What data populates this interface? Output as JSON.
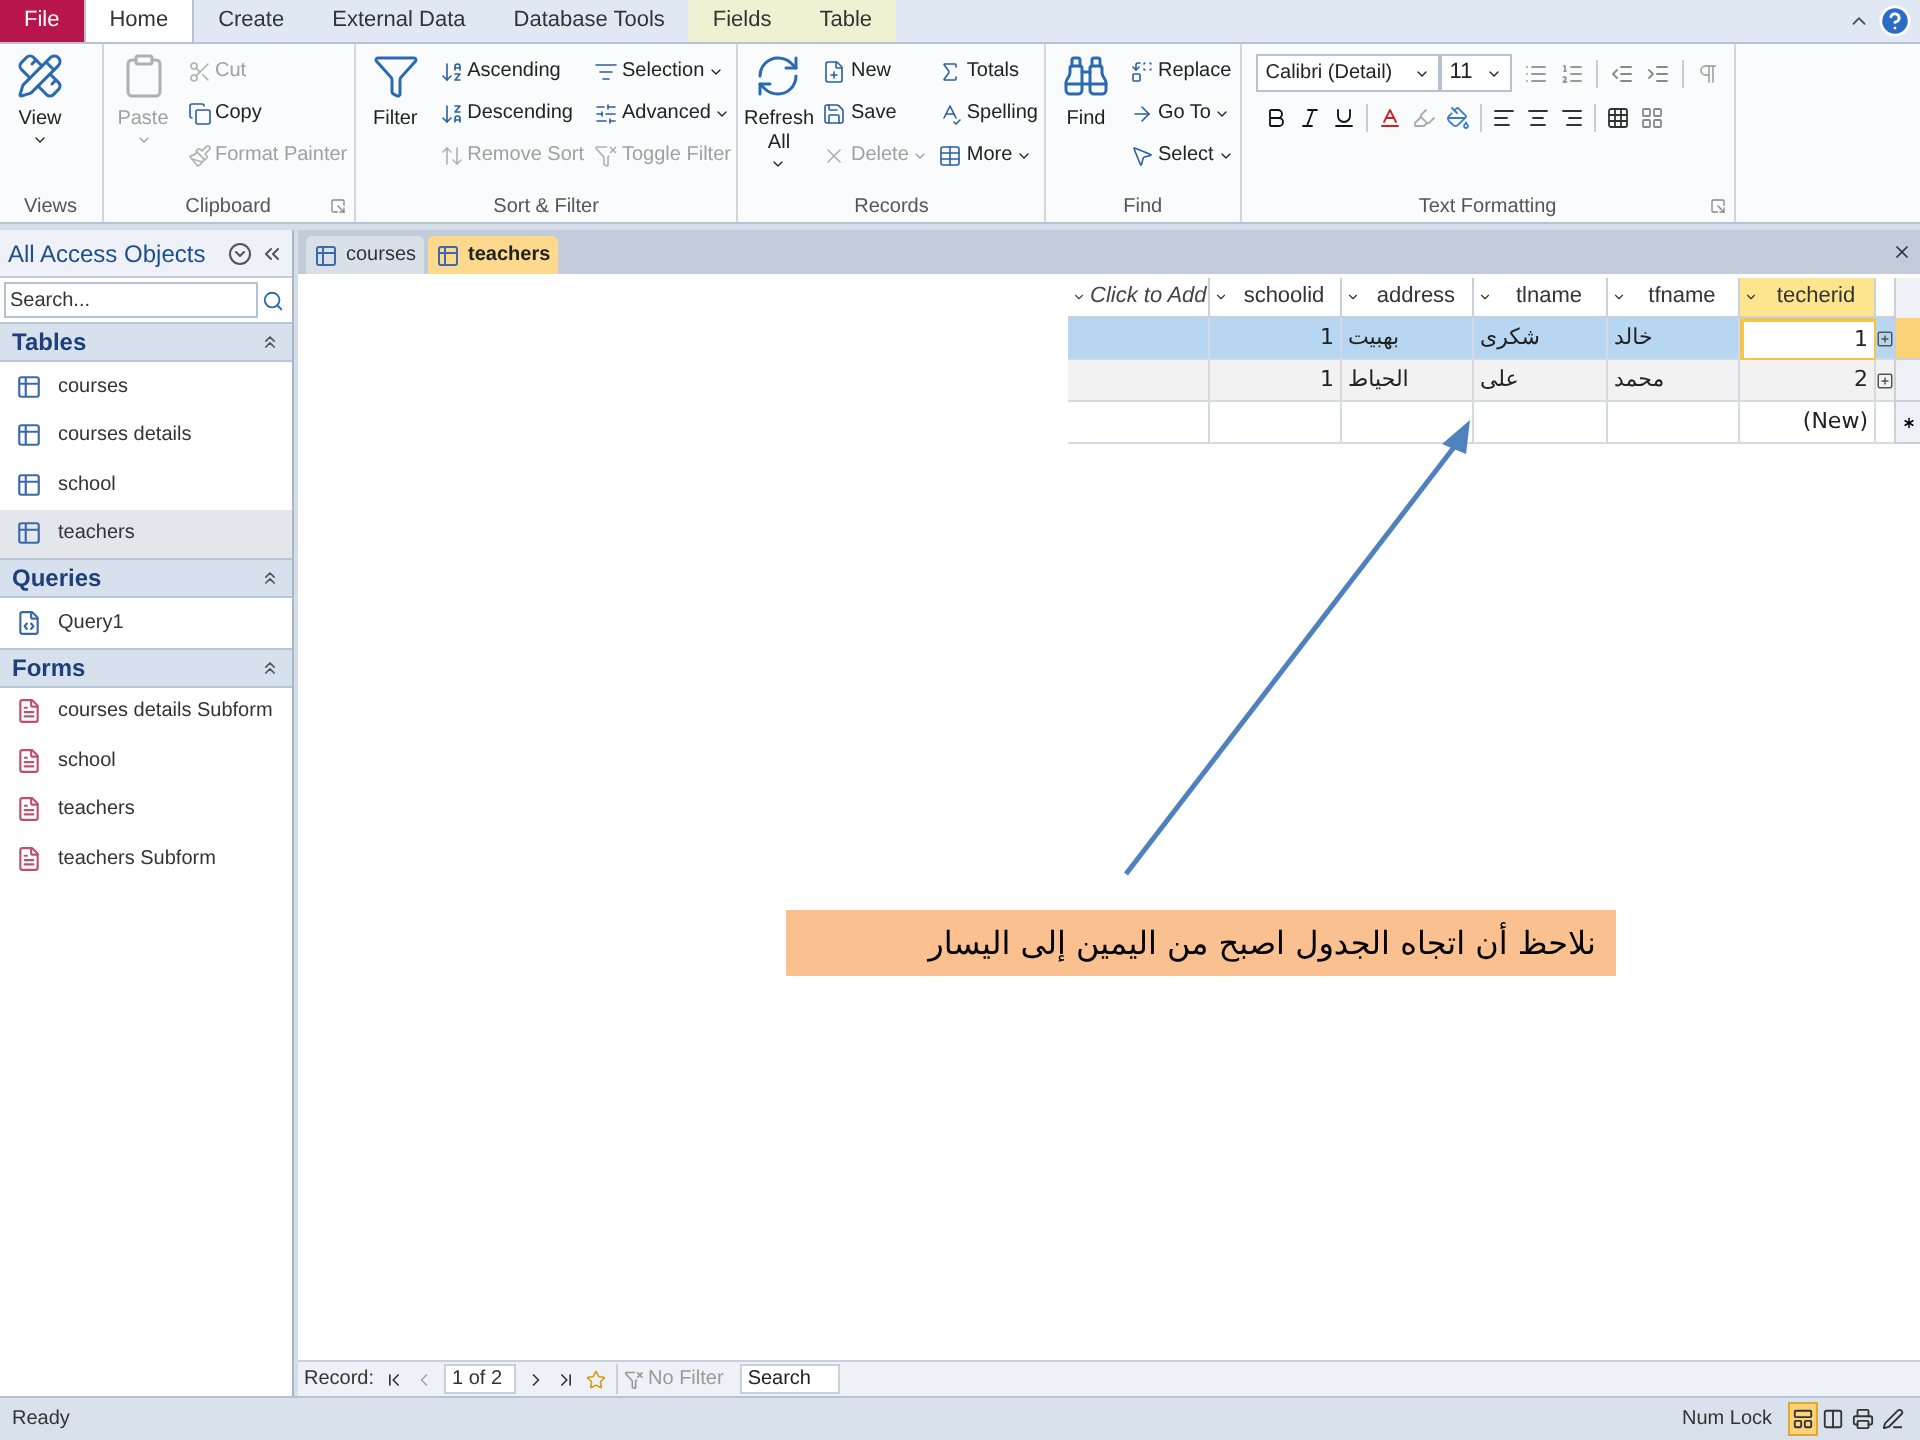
{
  "menu_tabs": [
    {
      "label": "File",
      "kind": "file",
      "selected": false
    },
    {
      "label": "Home",
      "kind": "tab",
      "selected": true
    },
    {
      "label": "Create",
      "kind": "tab",
      "selected": false
    },
    {
      "label": "External Data",
      "kind": "tab",
      "selected": false
    },
    {
      "label": "Database Tools",
      "kind": "tab",
      "selected": false
    },
    {
      "label": "Fields",
      "kind": "contextual",
      "selected": false
    },
    {
      "label": "Table",
      "kind": "contextual",
      "selected": false
    }
  ],
  "ribbon": [
    {
      "title": "Views",
      "kind": "buttons",
      "launcher": false,
      "items": [
        {
          "label": "View",
          "kind": "large",
          "disabled": false,
          "dropdown": true
        }
      ]
    },
    {
      "title": "Clipboard",
      "kind": "buttons",
      "launcher": true,
      "items": [
        {
          "label": "Paste",
          "kind": "large",
          "disabled": true,
          "dropdown": true
        },
        {
          "label": "Cut",
          "kind": "small",
          "disabled": true,
          "dropdown": false
        },
        {
          "label": "Copy",
          "kind": "small",
          "disabled": false,
          "dropdown": false
        },
        {
          "label": "Format Painter",
          "kind": "small",
          "disabled": true,
          "dropdown": false
        }
      ]
    },
    {
      "title": "Sort & Filter",
      "kind": "buttons",
      "launcher": false,
      "items": [
        {
          "label": "Filter",
          "kind": "large",
          "disabled": false,
          "dropdown": false
        },
        {
          "label": "Ascending",
          "kind": "small",
          "disabled": false,
          "dropdown": false
        },
        {
          "label": "Descending",
          "kind": "small",
          "disabled": false,
          "dropdown": false
        },
        {
          "label": "Remove Sort",
          "kind": "small",
          "disabled": true,
          "dropdown": false
        },
        {
          "label": "Selection",
          "kind": "small",
          "disabled": false,
          "dropdown": true
        },
        {
          "label": "Advanced",
          "kind": "small",
          "disabled": false,
          "dropdown": true
        },
        {
          "label": "Toggle Filter",
          "kind": "small",
          "disabled": true,
          "dropdown": false
        }
      ]
    },
    {
      "title": "Records",
      "kind": "buttons",
      "launcher": false,
      "items": [
        {
          "label": "Refresh All",
          "kind": "large",
          "disabled": false,
          "dropdown": true
        },
        {
          "label": "New",
          "kind": "small",
          "disabled": false,
          "dropdown": false
        },
        {
          "label": "Save",
          "kind": "small",
          "disabled": false,
          "dropdown": false
        },
        {
          "label": "Delete",
          "kind": "small",
          "disabled": true,
          "dropdown": true
        },
        {
          "label": "Totals",
          "kind": "small",
          "disabled": false,
          "dropdown": false
        },
        {
          "label": "Spelling",
          "kind": "small",
          "disabled": false,
          "dropdown": false
        },
        {
          "label": "More",
          "kind": "small",
          "disabled": false,
          "dropdown": true
        }
      ]
    },
    {
      "title": "Find",
      "kind": "buttons",
      "launcher": false,
      "items": [
        {
          "label": "Find",
          "kind": "large",
          "disabled": false,
          "dropdown": false
        },
        {
          "label": "Replace",
          "kind": "small",
          "disabled": false,
          "dropdown": false
        },
        {
          "label": "Go To",
          "kind": "small",
          "disabled": false,
          "dropdown": true
        },
        {
          "label": "Select",
          "kind": "small",
          "disabled": false,
          "dropdown": true
        }
      ]
    },
    {
      "title": "Text Formatting",
      "kind": "formatting",
      "launcher": true,
      "font": "Calibri (Detail)",
      "size": "11"
    }
  ],
  "nav": {
    "title": "All Access Objects",
    "search": {
      "placeholder": "Search..."
    },
    "sections": [
      {
        "title": "Tables",
        "kind": "table",
        "expanded": true,
        "items": [
          {
            "label": "courses",
            "selected": false
          },
          {
            "label": "courses details",
            "selected": false
          },
          {
            "label": "school",
            "selected": false
          },
          {
            "label": "teachers",
            "selected": true
          }
        ]
      },
      {
        "title": "Queries",
        "kind": "query",
        "expanded": true,
        "items": [
          {
            "label": "Query1",
            "selected": false
          }
        ]
      },
      {
        "title": "Forms",
        "kind": "form",
        "expanded": true,
        "items": [
          {
            "label": "courses details Subform",
            "selected": false
          },
          {
            "label": "school",
            "selected": false
          },
          {
            "label": "teachers",
            "selected": false
          },
          {
            "label": "teachers Subform",
            "selected": false
          }
        ]
      }
    ]
  },
  "doc_tabs": [
    {
      "label": "courses",
      "selected": false
    },
    {
      "label": "teachers",
      "selected": true
    }
  ],
  "datasheet": {
    "columns": [
      {
        "label": "Click to Add",
        "kind": "add",
        "selected": false
      },
      {
        "label": "schoolid",
        "kind": "number",
        "selected": false
      },
      {
        "label": "address",
        "kind": "text",
        "selected": false
      },
      {
        "label": "tlname",
        "kind": "text",
        "selected": false
      },
      {
        "label": "tfname",
        "kind": "text",
        "selected": false
      },
      {
        "label": "techerid",
        "kind": "number",
        "selected": true
      }
    ],
    "rows": [
      {
        "kind": "record",
        "selected": true,
        "cells": [
          null,
          "1",
          "بهبيت",
          "شكرى",
          "خالد",
          "1"
        ]
      },
      {
        "kind": "record",
        "selected": false,
        "cells": [
          null,
          "1",
          "الحياط",
          "على",
          "محمد",
          "2"
        ]
      },
      {
        "kind": "new",
        "selected": false,
        "cells": [
          null,
          null,
          null,
          null,
          null,
          "(New)"
        ]
      }
    ]
  },
  "record_nav": {
    "label": "Record:",
    "position": "1 of 2",
    "filter": {
      "label": "No Filter",
      "disabled": true
    },
    "search": {
      "placeholder": "Search"
    }
  },
  "note": "نلاحظ أن اتجاه الجدول اصبح من اليمين إلى اليسار",
  "status_bar": {
    "left": "Ready",
    "right": "Num Lock",
    "views": [
      {
        "selected": true
      },
      {
        "selected": false
      },
      {
        "selected": false
      },
      {
        "selected": false
      }
    ]
  }
}
